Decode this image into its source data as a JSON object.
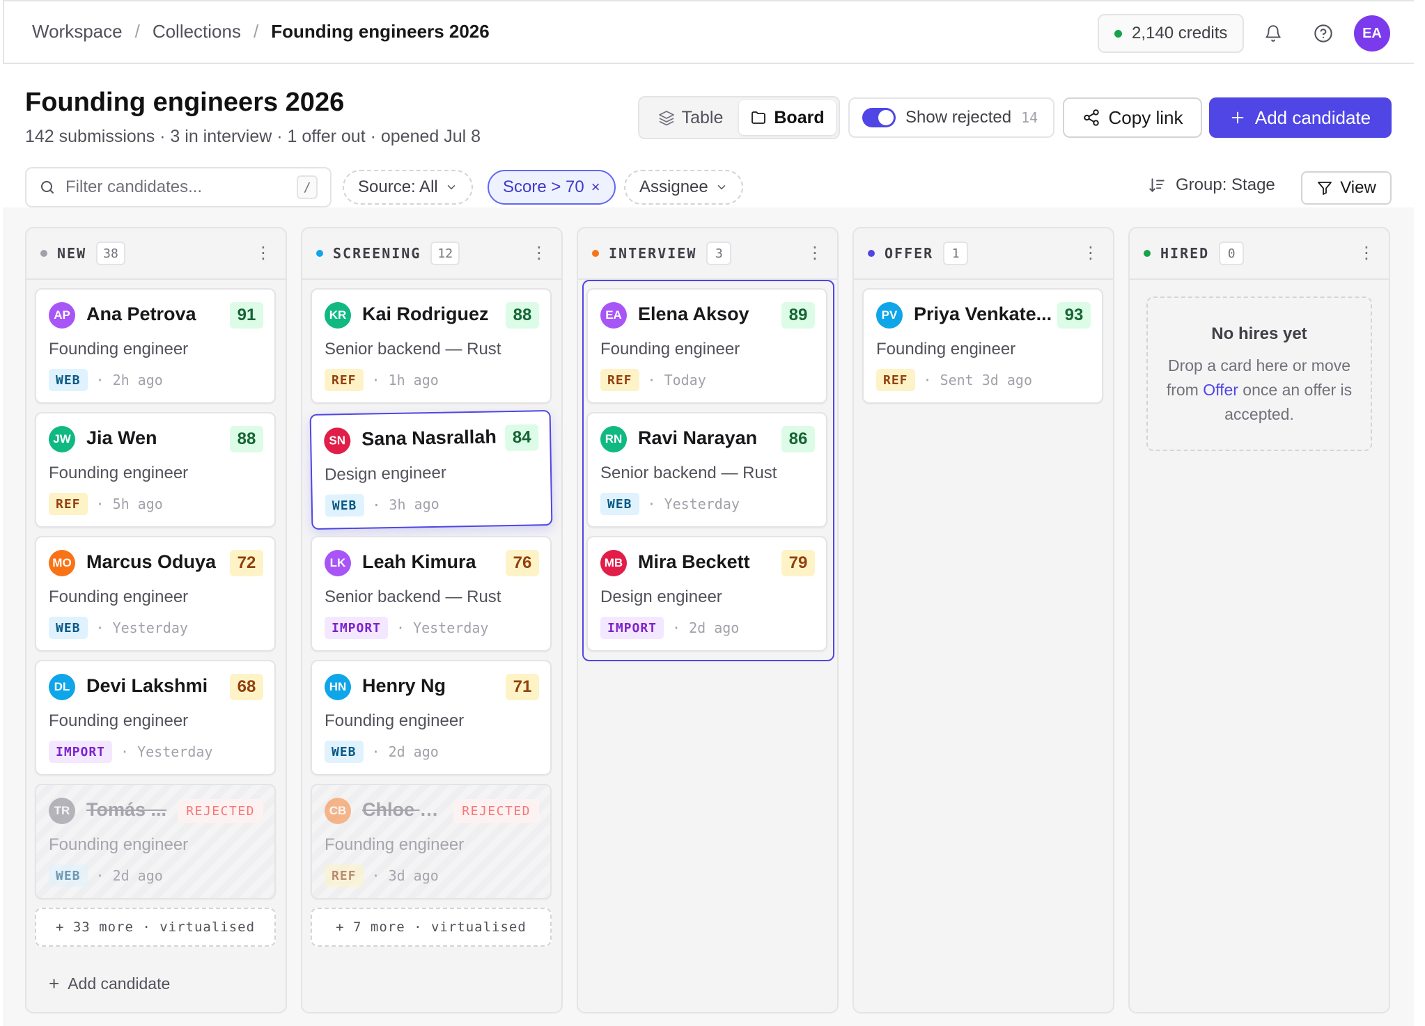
{
  "breadcrumb": [
    "Workspace",
    "Collections",
    "Founding engineers 2026"
  ],
  "credits": "2,140 credits",
  "user_initials": "EA",
  "page": {
    "title": "Founding engineers 2026",
    "subtitle": "142 submissions · 3 in interview · 1 offer out · opened Jul 8"
  },
  "view_toggle": {
    "table": "Table",
    "board": "Board",
    "active": "Board"
  },
  "show_rejected": {
    "label": "Show rejected",
    "count": "14",
    "on": true
  },
  "copy_link": "Copy link",
  "add_candidate": "Add candidate",
  "search": {
    "placeholder": "Filter candidates...",
    "shortcut": "/"
  },
  "filters": {
    "source": "Source: All",
    "score": "Score > 70",
    "assignee": "Assignee"
  },
  "group_by": "Group: Stage",
  "view": "View",
  "columns": [
    {
      "title": "NEW",
      "count": "38",
      "color": "#a1a1aa",
      "cards": [
        {
          "initials": "AP",
          "avatar": "#a855f7",
          "name": "Ana Petrova",
          "score": "91",
          "tone": "green",
          "role": "Founding engineer",
          "tag": "WEB",
          "time": "2h ago"
        },
        {
          "initials": "JW",
          "avatar": "#10b981",
          "name": "Jia Wen",
          "score": "88",
          "tone": "green",
          "role": "Founding engineer",
          "tag": "REF",
          "time": "5h ago"
        },
        {
          "initials": "MO",
          "avatar": "#f97316",
          "name": "Marcus Oduya",
          "score": "72",
          "tone": "amber",
          "role": "Founding engineer",
          "tag": "WEB",
          "time": "Yesterday"
        },
        {
          "initials": "DL",
          "avatar": "#0ea5e9",
          "name": "Devi Lakshmi",
          "score": "68",
          "tone": "amber",
          "role": "Founding engineer",
          "tag": "IMPORT",
          "time": "Yesterday"
        },
        {
          "initials": "TR",
          "avatar": "#71717a",
          "name": "Tomás ...",
          "badge": "REJECTED",
          "role": "Founding engineer",
          "tag": "WEB",
          "time": "2d ago"
        }
      ],
      "more": "+ 33 more · virtualised",
      "add": "Add candidate"
    },
    {
      "title": "SCREENING",
      "count": "12",
      "color": "#0ea5e9",
      "cards": [
        {
          "initials": "KR",
          "avatar": "#10b981",
          "name": "Kai Rodriguez",
          "score": "88",
          "tone": "green",
          "role": "Senior backend — Rust",
          "tag": "REF",
          "time": "1h ago"
        },
        {
          "initials": "SN",
          "avatar": "#e11d48",
          "name": "Sana Nasrallah",
          "score": "84",
          "tone": "green",
          "role": "Design engineer",
          "tag": "WEB",
          "time": "3h ago"
        },
        {
          "initials": "LK",
          "avatar": "#a855f7",
          "name": "Leah Kimura",
          "score": "76",
          "tone": "amber",
          "role": "Senior backend — Rust",
          "tag": "IMPORT",
          "time": "Yesterday"
        },
        {
          "initials": "HN",
          "avatar": "#0ea5e9",
          "name": "Henry Ng",
          "score": "71",
          "tone": "amber",
          "role": "Founding engineer",
          "tag": "WEB",
          "time": "2d ago"
        },
        {
          "initials": "CB",
          "avatar": "#f97316",
          "name": "Chloe B...",
          "badge": "REJECTED",
          "role": "Founding engineer",
          "tag": "REF",
          "time": "3d ago"
        }
      ],
      "more": "+ 7 more · virtualised"
    },
    {
      "title": "INTERVIEW",
      "count": "3",
      "color": "#f97316",
      "cards": [
        {
          "initials": "EA",
          "avatar": "#a855f7",
          "name": "Elena Aksoy",
          "score": "89",
          "tone": "green",
          "role": "Founding engineer",
          "tag": "REF",
          "time": "Today"
        },
        {
          "initials": "RN",
          "avatar": "#10b981",
          "name": "Ravi Narayan",
          "score": "86",
          "tone": "green",
          "role": "Senior backend — Rust",
          "tag": "WEB",
          "time": "Yesterday"
        },
        {
          "initials": "MB",
          "avatar": "#e11d48",
          "name": "Mira Beckett",
          "score": "79",
          "tone": "amber",
          "role": "Design engineer",
          "tag": "IMPORT",
          "time": "2d ago"
        }
      ]
    },
    {
      "title": "OFFER",
      "count": "1",
      "color": "#4f46e5",
      "cards": [
        {
          "initials": "PV",
          "avatar": "#0ea5e9",
          "name": "Priya Venkate...",
          "score": "93",
          "tone": "green",
          "role": "Founding engineer",
          "tag": "REF",
          "time": "Sent 3d ago"
        }
      ]
    },
    {
      "title": "HIRED",
      "count": "0",
      "color": "#16a34a",
      "empty": {
        "title": "No hires yet",
        "before": "Drop a card here or move from ",
        "link": "Offer",
        "after": " once an offer is accepted."
      }
    }
  ]
}
